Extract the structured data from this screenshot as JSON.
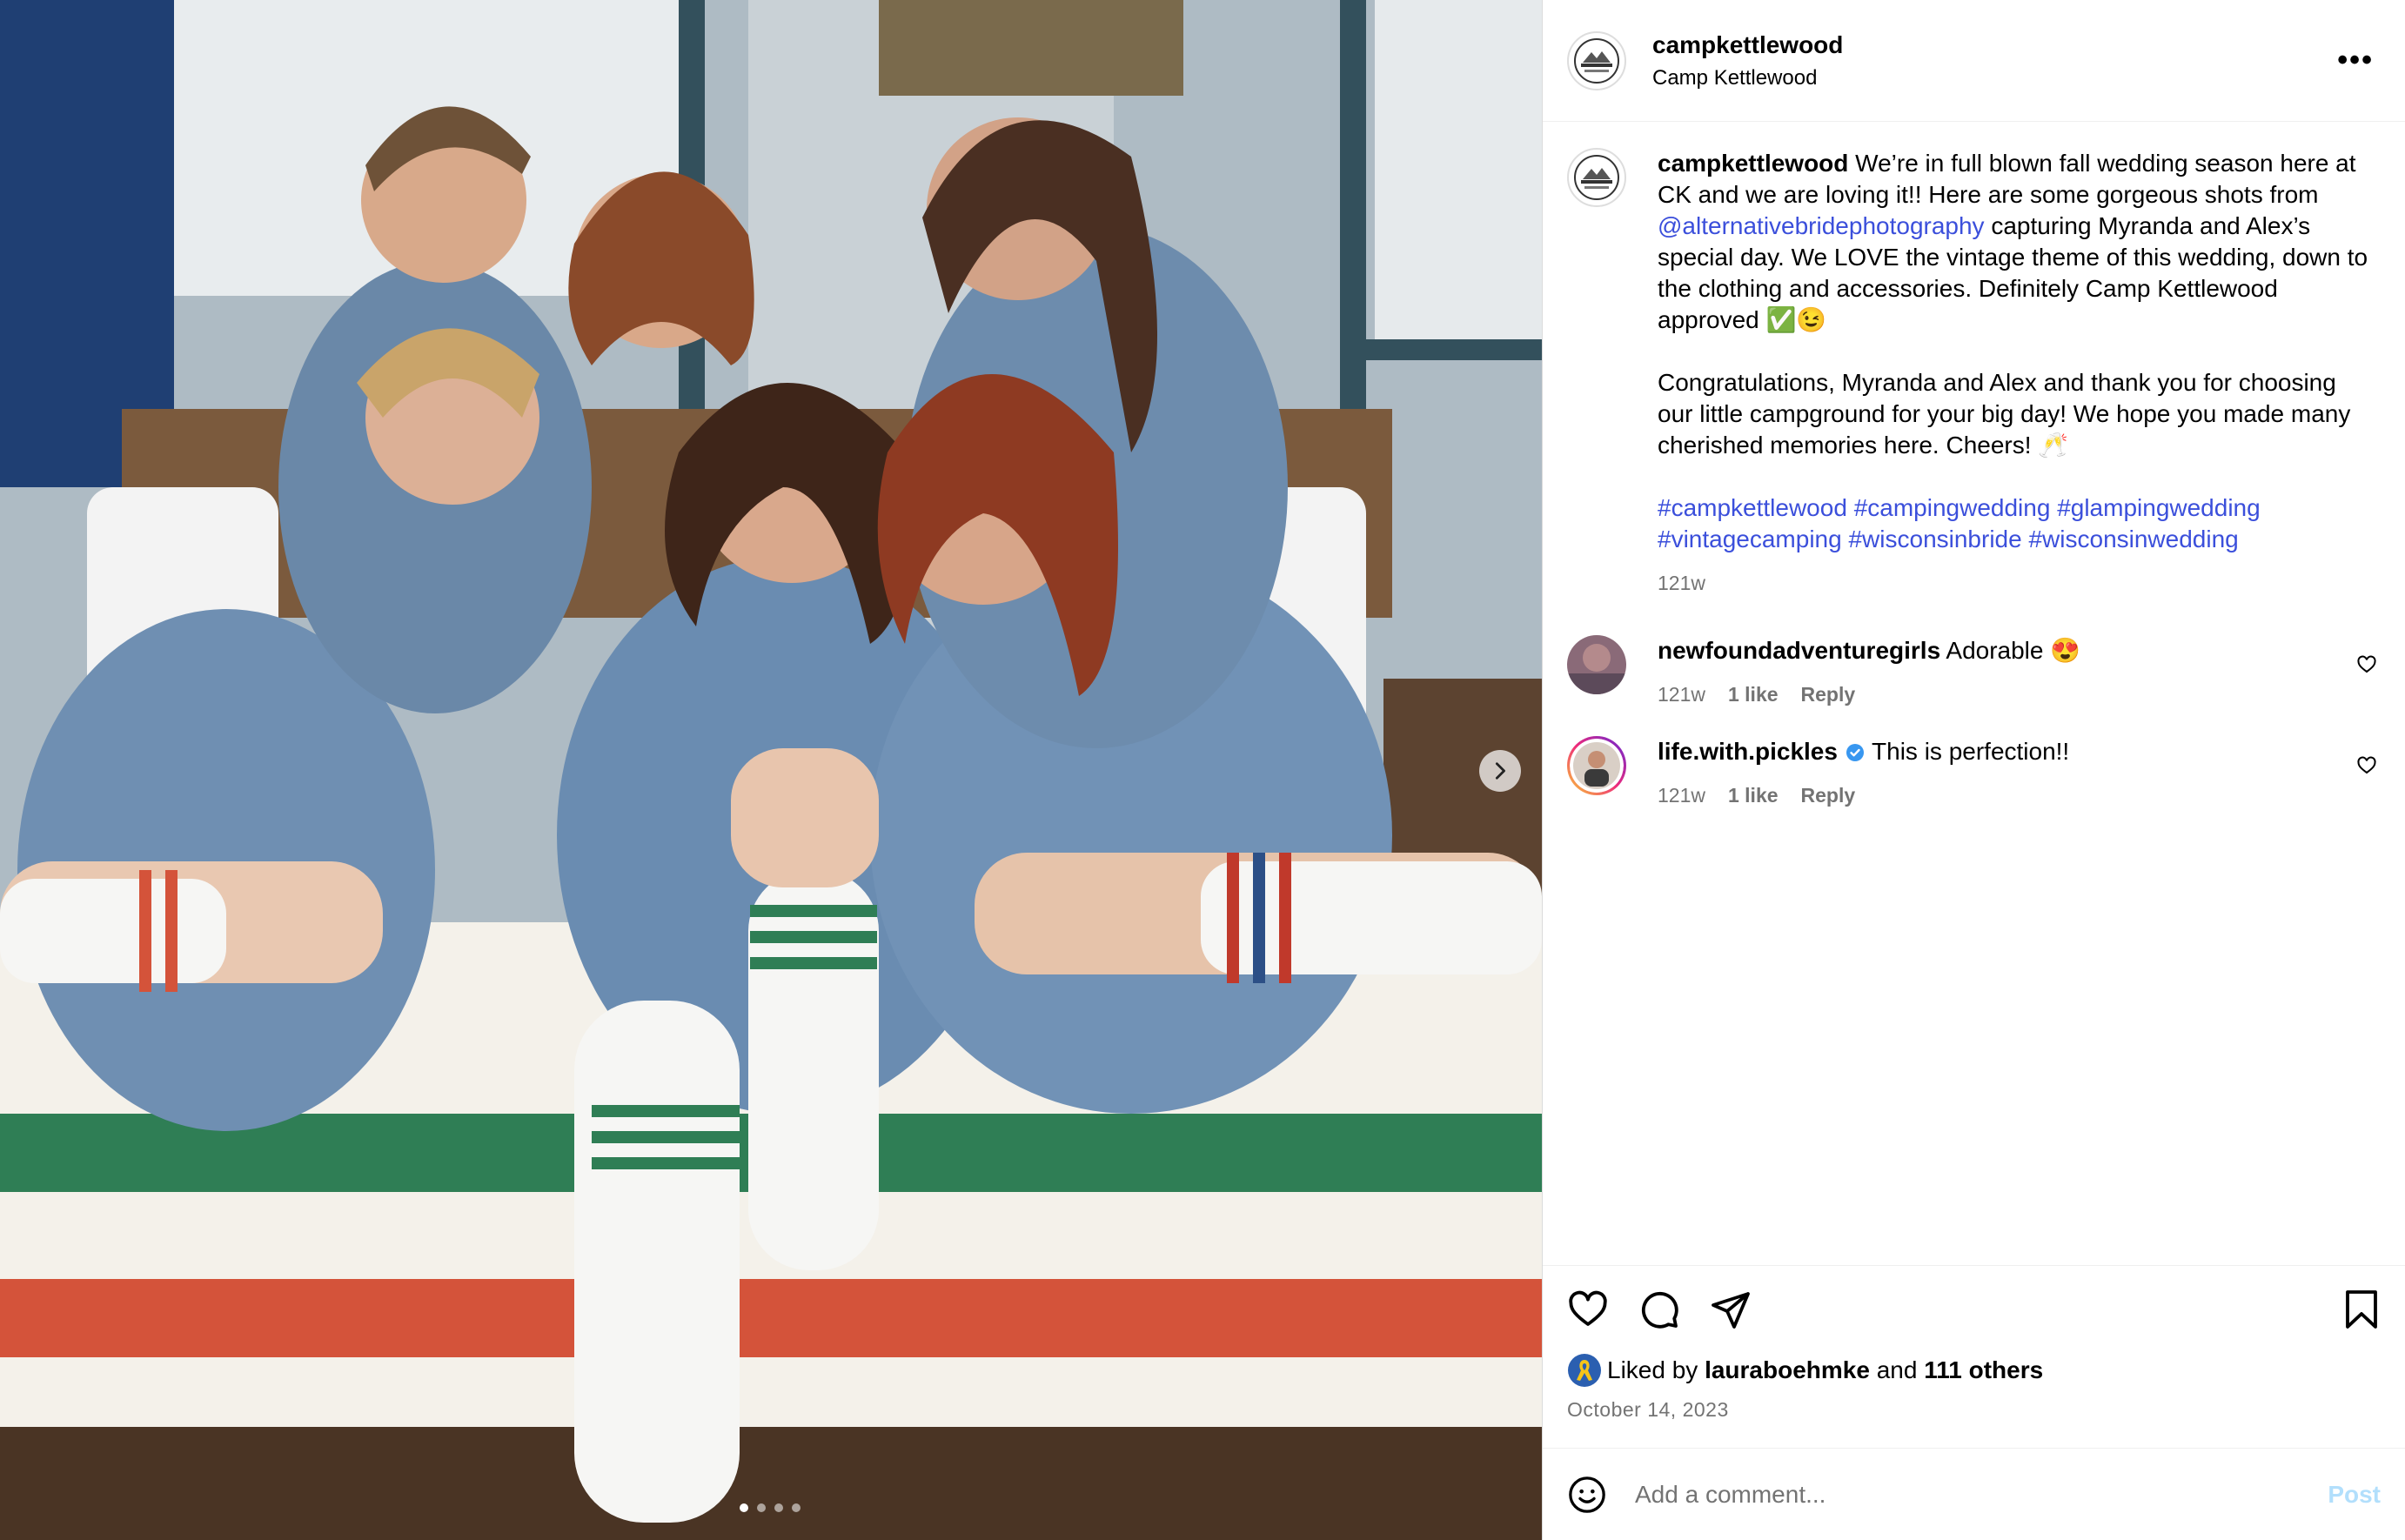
{
  "post": {
    "username": "campkettlewood",
    "location": "Camp Kettlewood",
    "more_icon": "more-horizontal-icon"
  },
  "caption": {
    "username": "campkettlewood",
    "text1": " We’re in full blown fall wedding season here at CK and we are loving it!! Here are some gorgeous shots from ",
    "mention": "@alternativebridephotography",
    "text2": " capturing Myranda and Alex’s special day. We LOVE the vintage theme of this wedding, down to the clothing and accessories. Definitely Camp Kettlewood approved ✅😉",
    "para2": "Congratulations, Myranda and Alex and thank you for choosing our little campground for your big day! We hope you made many cherished memories here. Cheers! 🥂",
    "hashtags": [
      "#campkettlewood",
      "#campingwedding",
      "#glampingwedding",
      "#vintagecamping",
      "#wisconsinbride",
      "#wisconsinwedding"
    ],
    "time": "121w"
  },
  "comments": [
    {
      "username": "newfoundadventuregirls",
      "text": "Adorable 😍",
      "time": "121w",
      "likes": "1 like",
      "reply": "Reply",
      "verified": false
    },
    {
      "username": "life.with.pickles",
      "text": "This is perfection!!",
      "time": "121w",
      "likes": "1 like",
      "reply": "Reply",
      "verified": true
    }
  ],
  "footer": {
    "liked_prefix": "Liked by ",
    "liked_user": "lauraboehmke",
    "liked_and": " and ",
    "liked_others": "111 others",
    "date": "October 14, 2023",
    "comment_placeholder": "Add a comment...",
    "post_label": "Post"
  },
  "carousel": {
    "slides": 4,
    "current": 1
  },
  "colors": {
    "link": "#3b4fdb",
    "verified": "#3897f0",
    "post_disabled": "#b2dffc",
    "muted": "#737373"
  }
}
